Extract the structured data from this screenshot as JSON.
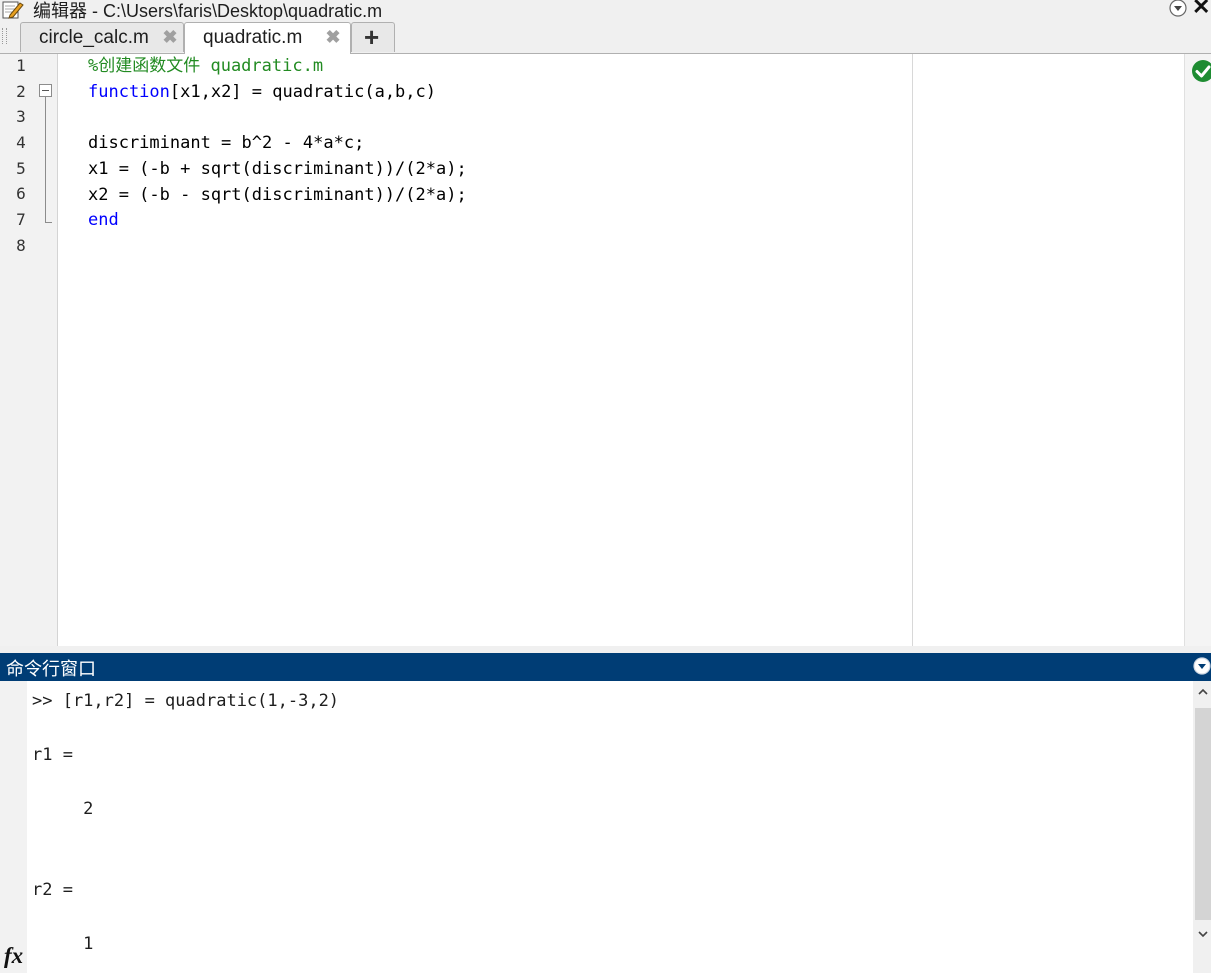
{
  "window": {
    "title": "编辑器 - C:\\Users\\faris\\Desktop\\quadratic.m",
    "close_glyph": "✕"
  },
  "tabs": [
    {
      "label": "circle_calc.m",
      "close_glyph": "✖",
      "active": false
    },
    {
      "label": "quadratic.m",
      "close_glyph": "✖",
      "active": true
    }
  ],
  "add_tab_glyph": "+",
  "editor": {
    "line_numbers": [
      "1",
      "2",
      "3",
      "4",
      "5",
      "6",
      "7",
      "8"
    ],
    "lines": [
      {
        "segments": [
          {
            "text": "%创建函数文件 quadratic.m",
            "style": "comment"
          }
        ]
      },
      {
        "segments": [
          {
            "text": "function",
            "style": "keyword"
          },
          {
            "text": "[x1,x2] = quadratic(a,b,c)",
            "style": "normal"
          }
        ]
      },
      {
        "segments": []
      },
      {
        "segments": [
          {
            "text": "discriminant = b^2 - 4*a*c;",
            "style": "normal"
          }
        ]
      },
      {
        "segments": [
          {
            "text": "x1 = (-b + sqrt(discriminant))/(2*a);",
            "style": "normal"
          }
        ]
      },
      {
        "segments": [
          {
            "text": "x2 = (-b - sqrt(discriminant))/(2*a);",
            "style": "normal"
          }
        ]
      },
      {
        "segments": [
          {
            "text": "end",
            "style": "keyword"
          }
        ]
      },
      {
        "segments": []
      }
    ],
    "status_icon": "check-circle-icon"
  },
  "command_window": {
    "title": "命令行窗口",
    "lines": [
      ">> [r1,r2] = quadratic(1,-3,2)",
      "r1 =",
      "     2",
      "r2 =",
      "     1"
    ],
    "prompt_icon": "fx"
  },
  "colors": {
    "keyword": "#0000ff",
    "comment": "#228b22",
    "cmd_header_bg": "#003d75",
    "check_green": "#1e8c32"
  }
}
